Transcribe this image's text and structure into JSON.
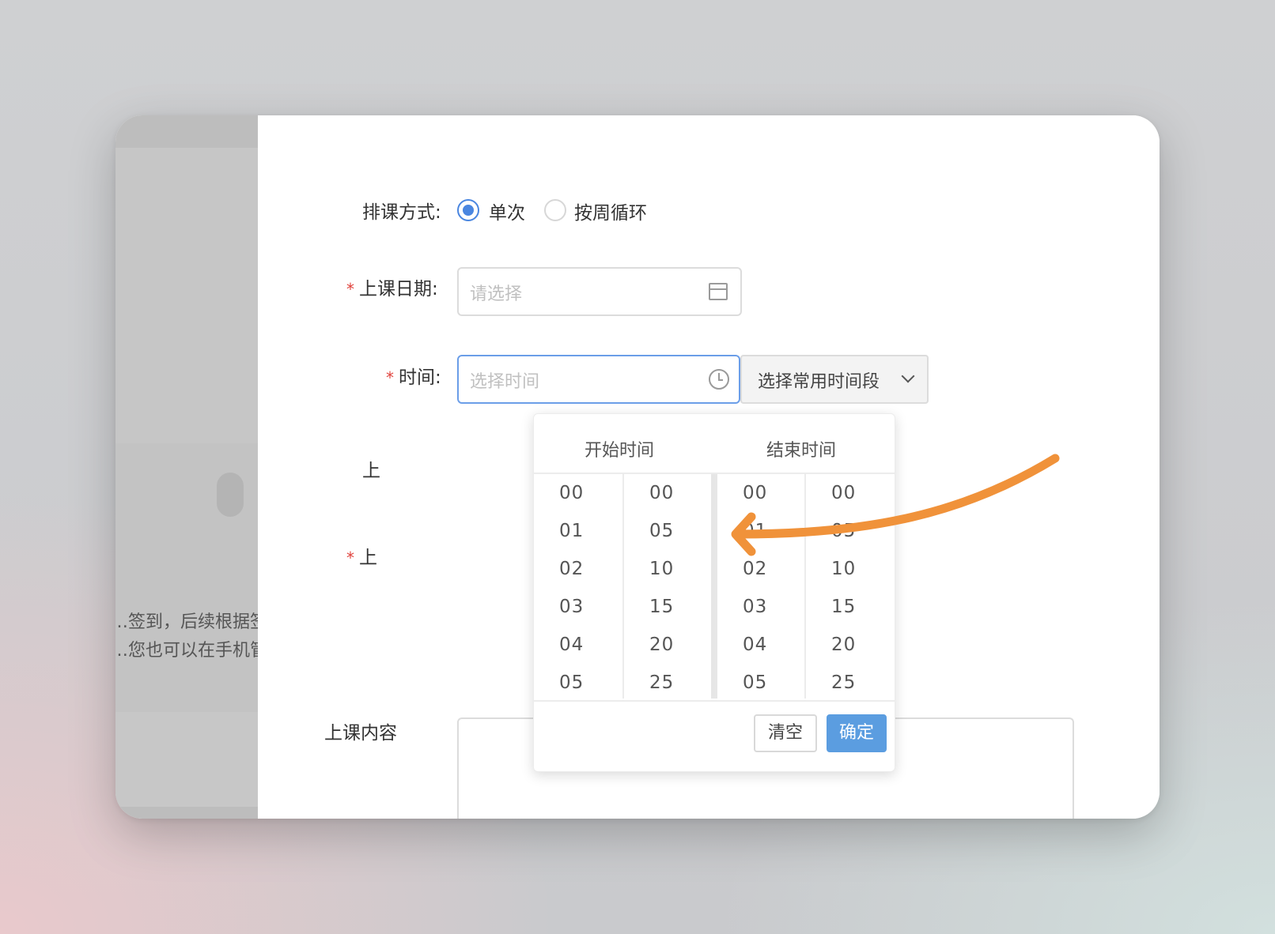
{
  "background": {
    "text_line1": "…签到，后续根据签",
    "text_line2": "…您也可以在手机管理"
  },
  "form": {
    "schedule_mode_label": "排课方式:",
    "schedule_mode_options": [
      "单次",
      "按周循环"
    ],
    "schedule_mode_selected": "单次",
    "date_label": "上课日期:",
    "date_placeholder": "请选择",
    "time_label": "时间:",
    "time_placeholder": "选择时间",
    "common_period_button": "选择常用时间段",
    "partial_label_1": "上",
    "partial_label_2": "上",
    "content_label": "上课内容",
    "required_mark": "*"
  },
  "time_picker": {
    "start_header": "开始时间",
    "end_header": "结束时间",
    "hours": [
      "00",
      "01",
      "02",
      "03",
      "04",
      "05"
    ],
    "minutes": [
      "00",
      "05",
      "10",
      "15",
      "20",
      "25"
    ],
    "clear_button": "清空",
    "confirm_button": "确定"
  },
  "annotation": {
    "arrow_color": "#f0923a",
    "points_to": "end-time-minutes-05"
  },
  "colors": {
    "primary": "#4a86e0",
    "confirm": "#5b9de0",
    "required": "#e0423c"
  }
}
